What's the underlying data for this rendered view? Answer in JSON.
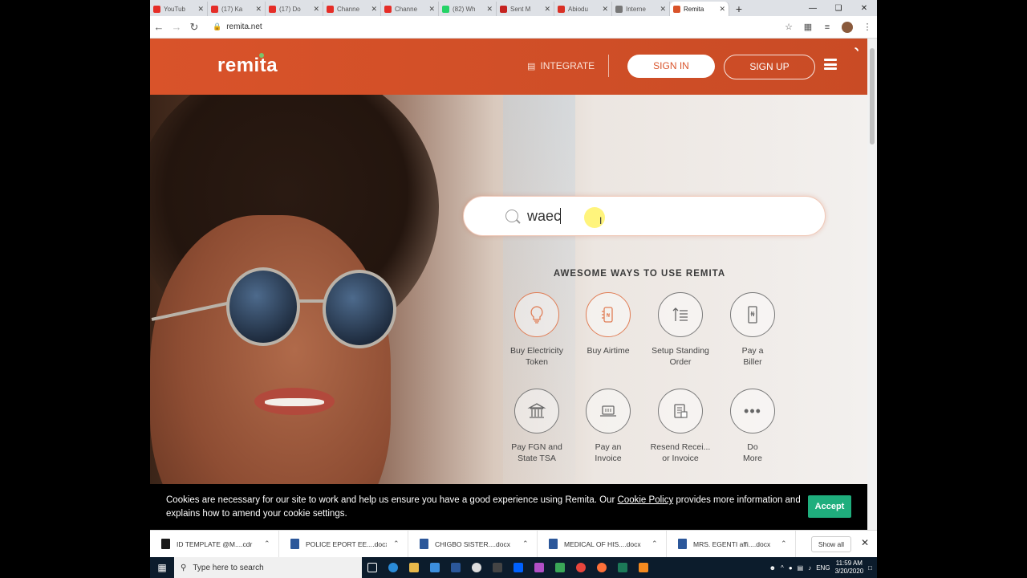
{
  "browser": {
    "tabs": [
      {
        "label": "YouTub",
        "color": "#e52d27"
      },
      {
        "label": "(17) Ka",
        "color": "#e52d27"
      },
      {
        "label": "(17) Do",
        "color": "#e52d27"
      },
      {
        "label": "Channe",
        "color": "#e52d27"
      },
      {
        "label": "Channe",
        "color": "#e52d27"
      },
      {
        "label": "(82) Wh",
        "color": "#25d366"
      },
      {
        "label": "Sent M",
        "color": "#c5221f"
      },
      {
        "label": "Abiodu",
        "color": "#d93025"
      },
      {
        "label": "Interne",
        "color": "#777777"
      },
      {
        "label": "Remita",
        "color": "#d9532a",
        "active": true
      }
    ],
    "new_tab": "+",
    "url": "remita.net"
  },
  "header": {
    "logo": "remita",
    "integrate": "INTEGRATE",
    "sign_in": "SIGN IN",
    "sign_up": "SIGN UP"
  },
  "search": {
    "value": "waec"
  },
  "ways": {
    "title": "AWESOME WAYS TO USE REMITA",
    "items": [
      {
        "line1": "Buy Electricity",
        "line2": "Token"
      },
      {
        "line1": "Buy Airtime",
        "line2": ""
      },
      {
        "line1": "Setup Standing",
        "line2": "Order"
      },
      {
        "line1": "Pay a",
        "line2": "Biller"
      },
      {
        "line1": "Pay FGN and",
        "line2": "State TSA"
      },
      {
        "line1": "Pay an",
        "line2": "Invoice"
      },
      {
        "line1": "Resend Recei...",
        "line2": "or Invoice"
      },
      {
        "line1": "Do",
        "line2": "More"
      }
    ]
  },
  "cookie": {
    "text_before": "Cookies are necessary for our site to work and help us ensure you have a good experience using Remita. Our ",
    "link": "Cookie Policy",
    "text_after": " provides more information and explains how to amend your cookie settings.",
    "accept": "Accept"
  },
  "downloads": {
    "items": [
      {
        "name": "ID TEMPLATE @M....cdr",
        "color": "#1a1a1a"
      },
      {
        "name": "POLICE EPORT EE....docx",
        "color": "#2b579a"
      },
      {
        "name": "CHIGBO SISTER....docx",
        "color": "#2b579a"
      },
      {
        "name": "MEDICAL OF HIS....docx",
        "color": "#2b579a"
      },
      {
        "name": "MRS. EGENTI affi....docx",
        "color": "#2b579a"
      }
    ],
    "show_all": "Show all"
  },
  "taskbar": {
    "search_placeholder": "Type here to search",
    "lang": "ENG",
    "time": "11:59 AM",
    "date": "3/20/2020"
  },
  "colors": {
    "brand": "#d9532a",
    "accept": "#1fae7d"
  }
}
